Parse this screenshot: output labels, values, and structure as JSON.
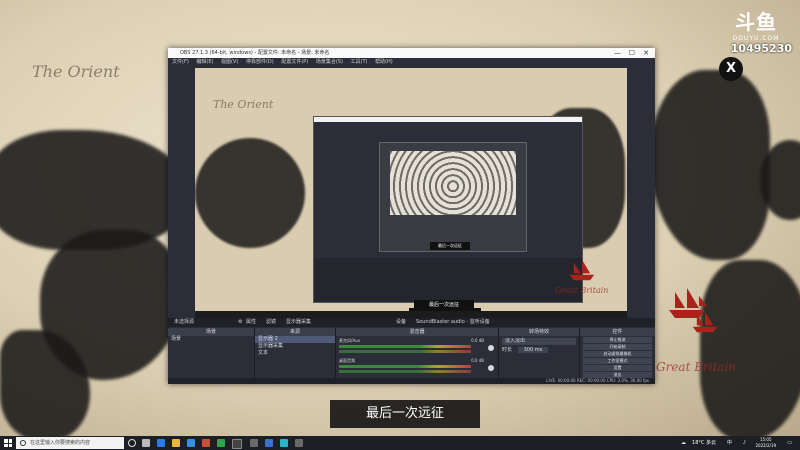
{
  "stream": {
    "logo_text": "斗鱼",
    "logo_subtext": "DOUYU.COM",
    "room_id": "10495230",
    "close_glyph": "X",
    "subtitle": "最后一次远征"
  },
  "map": {
    "label_orient": "The Orient",
    "label_britain": "Great Britain"
  },
  "obs": {
    "title": "OBS 27.1.3 (64-bit, windows) - 配置文件: 未命名 - 场景: 未命名",
    "menu": [
      "文件(F)",
      "编辑(E)",
      "视图(V)",
      "停靠部件(D)",
      "配置文件(P)",
      "场景集合(S)",
      "工具(T)",
      "帮助(H)"
    ],
    "preview_subtitle": "最后一次远征",
    "nested_subtitle_1": "最后一次远征",
    "nested_subtitle_2": "最后一次远征",
    "tabbar": {
      "no_source": "未选择源",
      "properties": "属性",
      "filters": "滤镜",
      "source_name": "显示器采集",
      "device": "设备",
      "device_value": "SoundBlaster audio - 监听设备"
    },
    "docks": {
      "scenes_title": "场景",
      "scene_item": "场景",
      "sources_title": "来源",
      "sources": [
        "显示器 2",
        "显示器采集",
        "文本"
      ],
      "mixer_title": "混音器",
      "mixer_channels": [
        {
          "name": "麦克风/Aux",
          "db": "0.0 dB"
        },
        {
          "name": "桌面音频",
          "db": "0.0 dB"
        }
      ],
      "transitions_title": "转场特效",
      "transition_value": "淡入淡出",
      "duration_label": "时长",
      "duration_value": "300 ms",
      "controls_title": "控件",
      "controls": [
        "停止推流",
        "开始录制",
        "启动虚拟摄像机",
        "工作室模式",
        "设置",
        "退出"
      ]
    },
    "status": "LIVE: 00:00:00  REC: 00:00:00  CPU: 3.0%, 30.00 fps"
  },
  "taskbar": {
    "search_placeholder": "在这里输入你要搜索的内容",
    "weather": "18°C 多云",
    "ime": "中",
    "time": "15:05",
    "date": "2022/2/19"
  },
  "colors": {
    "obs_bg": "#2b2e38",
    "obs_dock_header": "#3b3f4c",
    "taskbar_bg": "#1c1f24",
    "map_paper": "#e5dcc6",
    "map_ink": "#1b1a19",
    "ship_red": "#a8231b"
  }
}
